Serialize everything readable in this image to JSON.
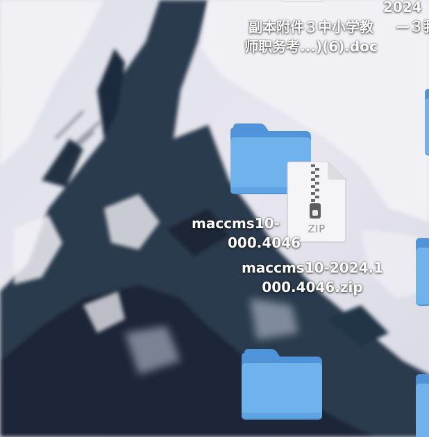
{
  "desktop": {
    "files": [
      {
        "name_line1": "副本附件３中小学教",
        "name_line2": "师职务考...)(6).doc",
        "icon": "doc-file-icon"
      },
      {
        "name_line1": "2024",
        "name_line2": "—３我",
        "icon": "file-icon"
      },
      {
        "name_line1": "maccms10-",
        "name_line2": "000.4046",
        "icon": "folder-icon"
      },
      {
        "name_line1": "maccms10-2024.1",
        "name_line2": "000.4046.zip",
        "icon": "zip-archive-icon",
        "badge": "ZIP"
      },
      {
        "icon": "folder-icon"
      },
      {
        "icon": "folder-icon"
      },
      {
        "icon": "folder-icon"
      },
      {
        "icon": "folder-icon"
      }
    ]
  },
  "colors": {
    "folder_front": "#6fb2ec",
    "folder_back": "#4f93d9",
    "label_text": "#ffffff",
    "zip_badge": "#8e8e93"
  }
}
